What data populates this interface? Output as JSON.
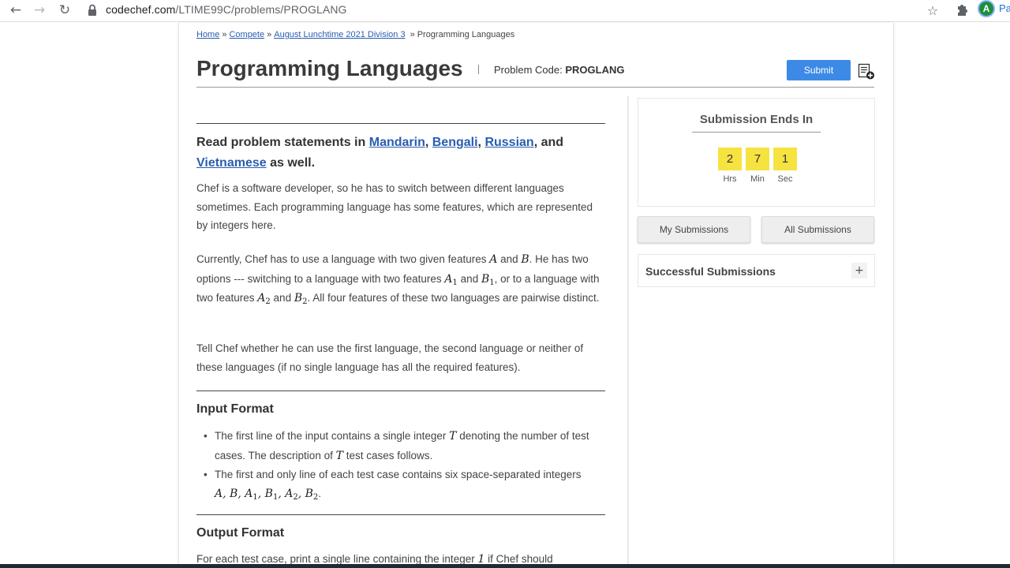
{
  "browser": {
    "url_host": "codechef.com",
    "url_path": "/LTIME99C/problems/PROGLANG",
    "profile_initial": "A",
    "profile_text": "Pa"
  },
  "breadcrumb": {
    "items": [
      "Home",
      "Compete",
      "August Lunchtime 2021 Division 3"
    ],
    "current": "Programming Languages",
    "separator": "»"
  },
  "header": {
    "title": "Programming Languages",
    "code_label": "Problem Code:",
    "code": "PROGLANG",
    "submit_label": "Submit"
  },
  "problem": {
    "translations": {
      "prefix": "Read problem statements in",
      "langs": [
        "Mandarin",
        "Bengali",
        "Russian",
        "Vietnamese"
      ],
      "and": "and",
      "suffix": "as well."
    },
    "p1": "Chef is a software developer, so he has to switch between different languages sometimes. Each programming language has some features, which are represented by integers here.",
    "p2": {
      "t1": "Currently, Chef has to use a language with two given features ",
      "t2": " and ",
      "t3": ". He has two options --- switching to a language with two features ",
      "t4": " and ",
      "t5": ", or to a language with two features ",
      "t6": " and ",
      "t7": ". All four features of these two languages are pairwise distinct.",
      "vA": "A",
      "vB": "B",
      "sub1": "1",
      "sub2": "2"
    },
    "p3": "Tell Chef whether he can use the first language, the second language or neither of these languages (if no single language has all the required features).",
    "input_heading": "Input Format",
    "input_b1": {
      "t1": "The first line of the input contains a single integer ",
      "t2": " denoting the number of test cases. The description of ",
      "t3": " test cases follows.",
      "vT": "T"
    },
    "input_b2": {
      "t1": "The first and only line of each test case contains six space-separated integers",
      "end": "."
    },
    "output_heading": "Output Format",
    "output_p": {
      "t1": "For each test case, print a single line containing the integer ",
      "v1": "1",
      "t2": " if Chef should"
    }
  },
  "timer": {
    "title": "Submission Ends In",
    "hours": "2",
    "minutes": "7",
    "seconds": "1",
    "hrs_label": "Hrs",
    "min_label": "Min",
    "sec_label": "Sec"
  },
  "submissions": {
    "my_label": "My Submissions",
    "all_label": "All Submissions",
    "successful_label": "Successful Submissions",
    "expand_symbol": "+"
  },
  "colors": {
    "link": "#2a5db0",
    "submit_button": "#3c8ae6",
    "timer_digit": "#f6e340"
  }
}
